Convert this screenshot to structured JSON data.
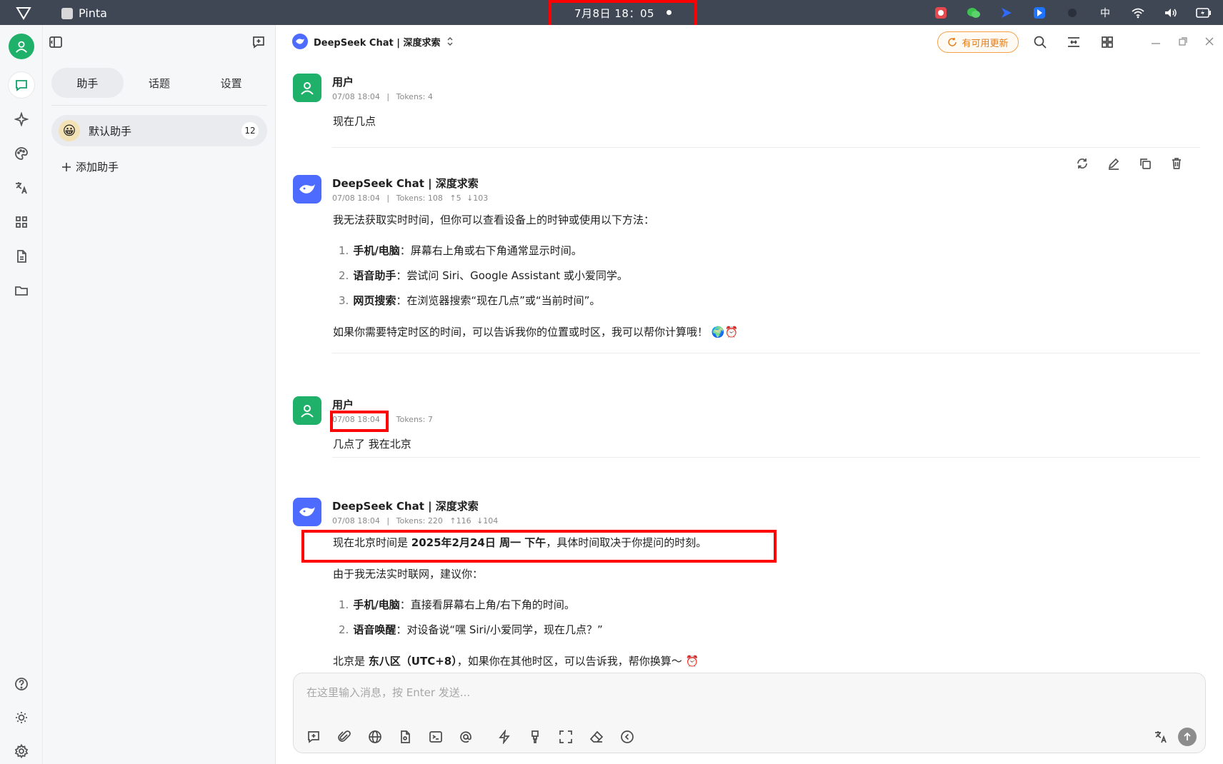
{
  "topbar": {
    "app_name": "Pinta",
    "clock": "7月8日  18：05",
    "ime": "中"
  },
  "sidebar": {
    "tabs": [
      {
        "label": "助手"
      },
      {
        "label": "话题"
      },
      {
        "label": "设置"
      }
    ],
    "assistant": {
      "name": "默认助手",
      "count": "12",
      "emoji": "😀"
    },
    "add_label": "添加助手"
  },
  "header": {
    "model": "DeepSeek Chat | 深度求索",
    "update_label": "有可用更新"
  },
  "messages": [
    {
      "role": "user",
      "name": "用户",
      "time": "07/08 18:04",
      "tokens": "Tokens: 4",
      "text": "现在几点"
    },
    {
      "role": "assistant",
      "name": "DeepSeek Chat | 深度求索",
      "time": "07/08 18:04",
      "tokens": "Tokens: 108",
      "up": "5",
      "down": "103",
      "intro": "我无法获取实时时间，但你可以查看设备上的时钟或使用以下方法：",
      "items": [
        {
          "num": "1.",
          "bold": "手机/电脑",
          "text": "：屏幕右上角或右下角通常显示时间。"
        },
        {
          "num": "2.",
          "bold": "语音助手",
          "text": "：尝试问 Siri、Google Assistant 或小爱同学。"
        },
        {
          "num": "3.",
          "bold": "网页搜索",
          "text": "：在浏览器搜索“现在几点”或“当前时间”。"
        }
      ],
      "outro": "如果你需要特定时区的时间，可以告诉我你的位置或时区，我可以帮你计算哦！ 🌍⏰"
    },
    {
      "role": "user",
      "name": "用户",
      "time": "07/08 18:04",
      "tokens": "Tokens: 7",
      "text": "几点了 我在北京"
    },
    {
      "role": "assistant",
      "name": "DeepSeek Chat | 深度求索",
      "time": "07/08 18:04",
      "tokens": "Tokens: 220",
      "up": "116",
      "down": "104",
      "answer_pre": "现在北京时间是 ",
      "answer_bold": "2025年2月24日 周一 下午",
      "answer_post": "，具体时间取决于你提问的时刻。",
      "intro": "由于我无法实时联网，建议你：",
      "items": [
        {
          "num": "1.",
          "bold": "手机/电脑",
          "text": "：直接看屏幕右上角/右下角的时间。"
        },
        {
          "num": "2.",
          "bold": "语音唤醒",
          "text": "：对设备说“嘿 Siri/小爱同学，现在几点？”"
        }
      ],
      "outro_pre": "北京是 ",
      "outro_bold": "东八区（UTC+8）",
      "outro_post": "，如果你在其他时区，可以告诉我，帮你换算～ ⏰"
    }
  ],
  "composer": {
    "placeholder": "在这里输入消息，按 Enter 发送..."
  },
  "colors": {
    "accent_green": "#1fb06a",
    "deepseek_blue": "#4d6bfe",
    "update_orange": "#e57a12",
    "highlight_red": "#ff0000"
  }
}
